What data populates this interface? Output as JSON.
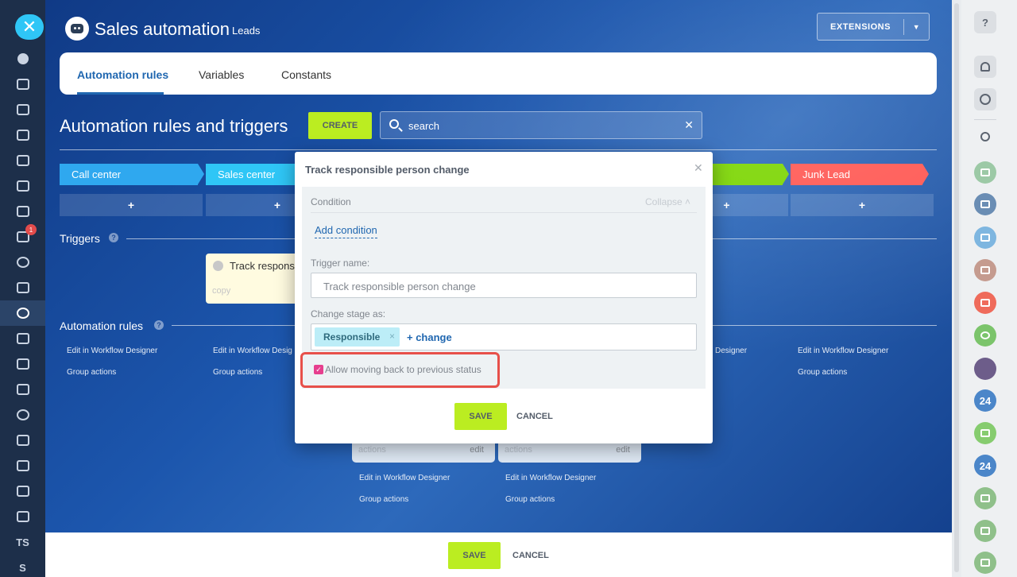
{
  "left_rail": {
    "close_icon": "close-icon",
    "mail_badge": "1",
    "text_items": [
      "TS",
      "S"
    ]
  },
  "header": {
    "title": "Sales automation",
    "subtitle": "Leads",
    "extensions_label": "EXTENSIONS"
  },
  "tabs": [
    "Automation rules",
    "Variables",
    "Constants"
  ],
  "section": {
    "title": "Automation rules and triggers",
    "create_label": "CREATE",
    "search_placeholder": "search"
  },
  "stages": [
    {
      "label": "Call center",
      "color": "#2fa8ef"
    },
    {
      "label": "Sales center",
      "color": "#2fc6f6"
    },
    {
      "label": "",
      "color": "#7bd500"
    },
    {
      "label": "Junk Lead",
      "color": "#ff5752"
    }
  ],
  "plus_label": "+",
  "triggers": {
    "heading": "Triggers",
    "help": "?",
    "card_name": "Track respons",
    "card_copy": "copy"
  },
  "automation_rules": {
    "heading": "Automation rules",
    "help": "?",
    "edit_link": "Edit in Workflow Designer",
    "edit_link_cut": "Edit in Workflow Desig",
    "edit_link_tail": "Designer",
    "group_actions": "Group actions",
    "card_actions": "actions",
    "card_edit": "edit"
  },
  "bottom_bar": {
    "save_label": "SAVE",
    "cancel_label": "CANCEL"
  },
  "modal": {
    "title": "Track responsible person change",
    "condition_label": "Condition",
    "collapse_label": "Collapse",
    "add_condition": "Add condition",
    "trigger_name_label": "Trigger name:",
    "trigger_name_value": "Track responsible person change",
    "change_stage_label": "Change stage as:",
    "tag_label": "Responsible",
    "tag_remove": "×",
    "change_link": "+ change",
    "checkbox_label": "Allow moving back to previous status",
    "checkbox_checked": true,
    "save_label": "SAVE",
    "cancel_label": "CANCEL"
  },
  "right_panel": {
    "avatar_24": "24"
  }
}
